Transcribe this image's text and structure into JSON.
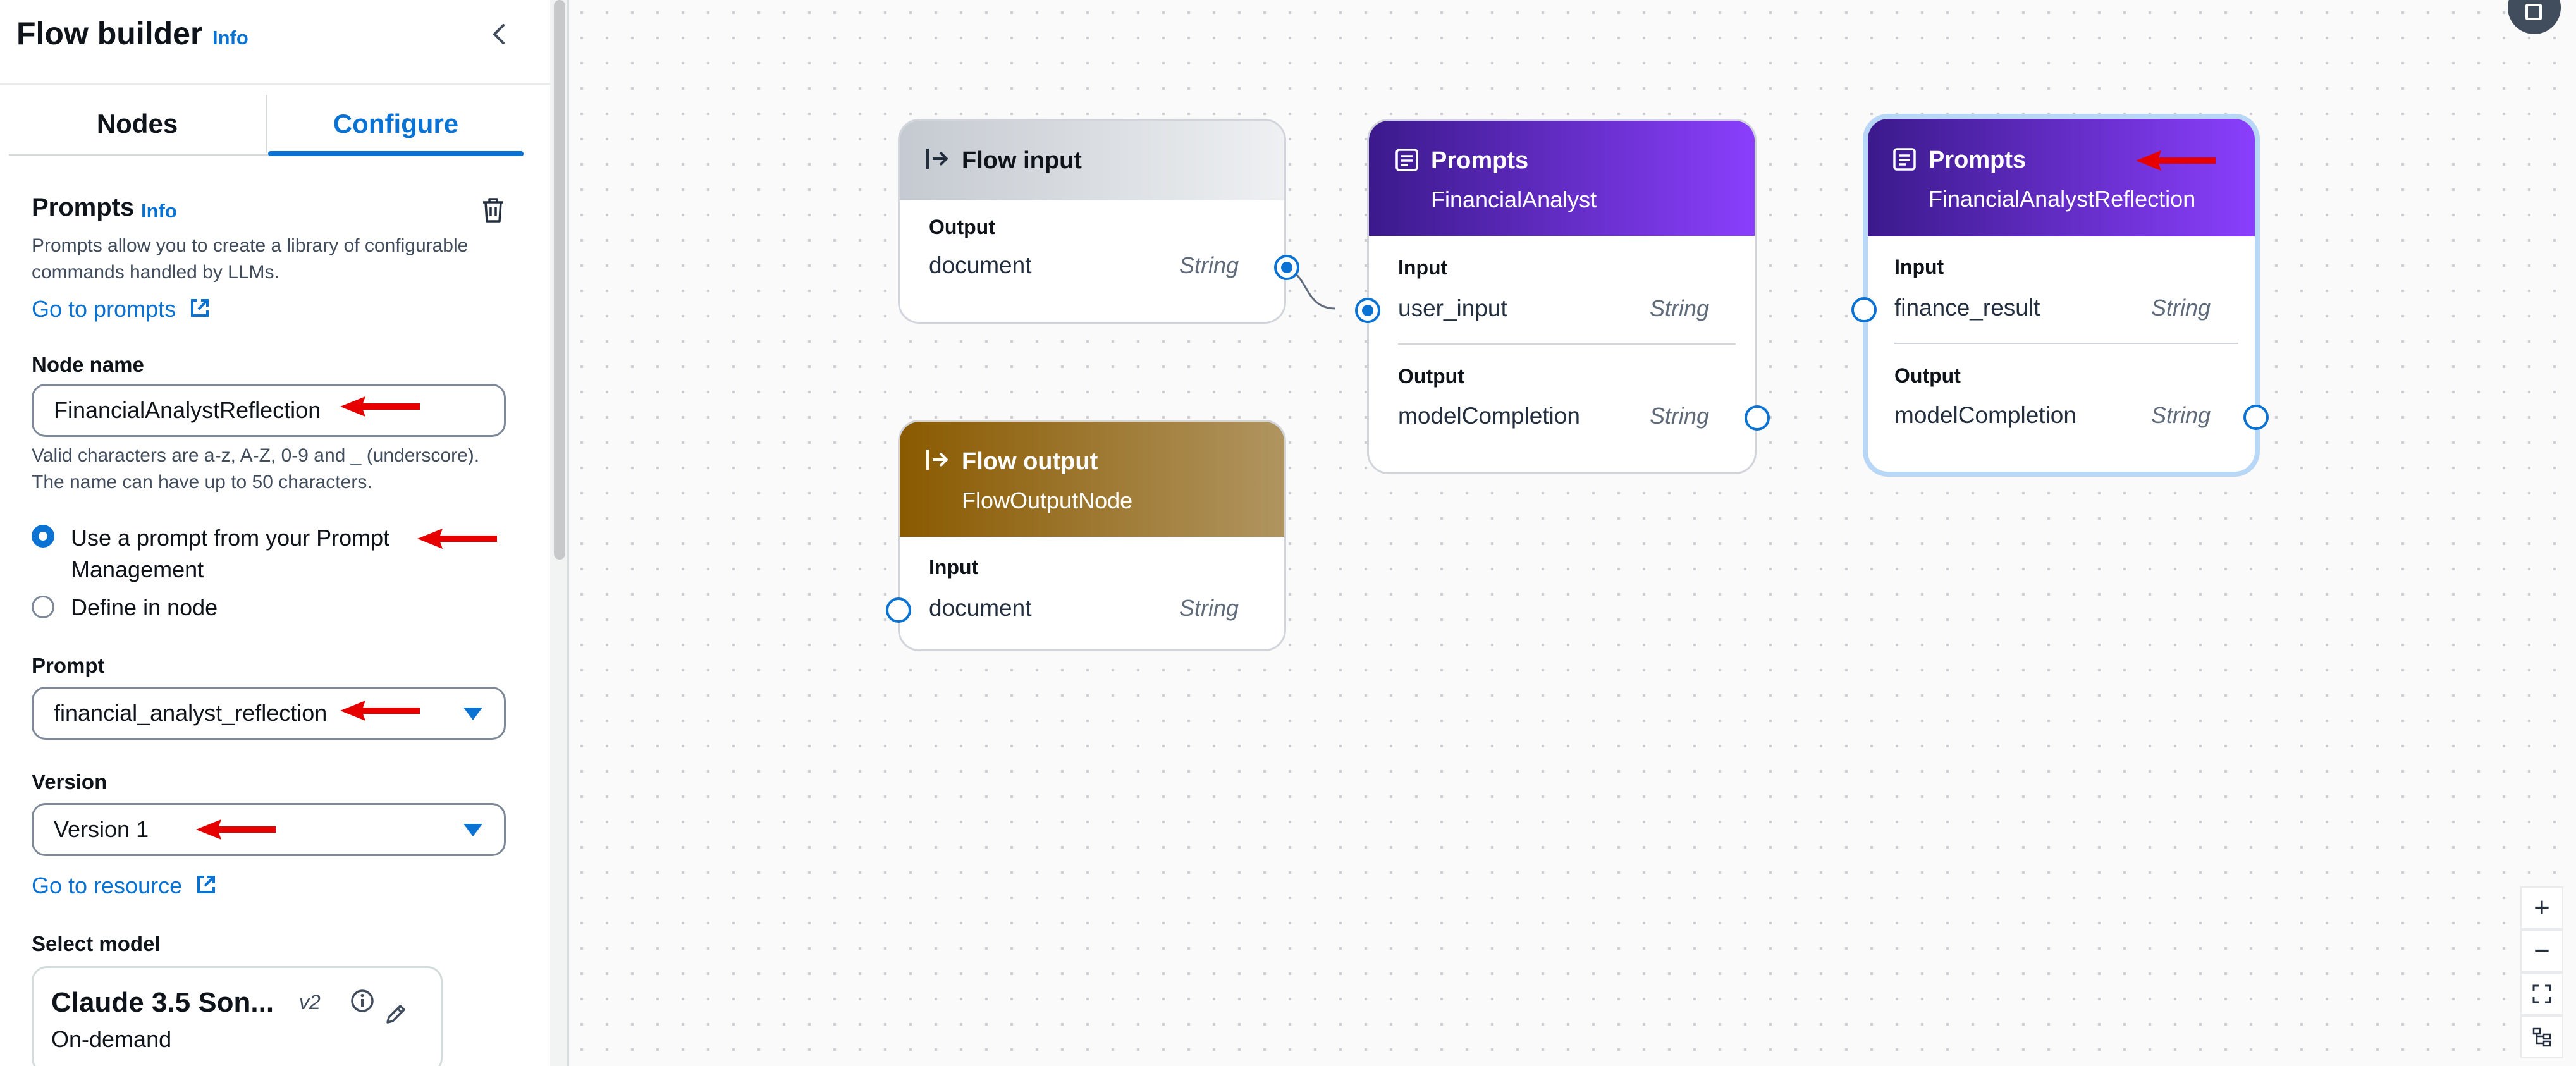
{
  "panel": {
    "title": "Flow builder",
    "info": "Info",
    "tabs": [
      {
        "label": "Nodes"
      },
      {
        "label": "Configure"
      }
    ],
    "section_title": "Prompts",
    "section_info": "Info",
    "description": "Prompts allow you to create a library of configurable commands handled by LLMs.",
    "go_to_prompts": "Go to prompts",
    "node_name_label": "Node name",
    "node_name_value": "FinancialAnalystReflection",
    "node_name_help_1": "Valid characters are a-z, A-Z, 0-9 and _ (underscore).",
    "node_name_help_2": "The name can have up to 50 characters.",
    "radio_option_1_line1": "Use a prompt from your Prompt",
    "radio_option_1_line2": "Management",
    "radio_option_2": "Define in node",
    "prompt_label": "Prompt",
    "prompt_value": "financial_analyst_reflection",
    "version_label": "Version",
    "version_value": "Version 1",
    "go_to_resource": "Go to resource",
    "select_model_label": "Select model",
    "model_name": "Claude 3.5 Son...",
    "model_version": "v2",
    "model_mode": "On-demand"
  },
  "nodes": {
    "flow_input": {
      "title": "Flow input",
      "output_label": "Output",
      "output_name": "document",
      "output_type": "String"
    },
    "flow_output": {
      "title": "Flow output",
      "subtitle": "FlowOutputNode",
      "input_label": "Input",
      "input_name": "document",
      "input_type": "String"
    },
    "financial_analyst": {
      "title": "Prompts",
      "subtitle": "FinancialAnalyst",
      "input_label": "Input",
      "input_name": "user_input",
      "input_type": "String",
      "output_label": "Output",
      "output_name": "modelCompletion",
      "output_type": "String"
    },
    "financial_analyst_reflection": {
      "title": "Prompts",
      "subtitle": "FinancialAnalystReflection",
      "input_label": "Input",
      "input_name": "finance_result",
      "input_type": "String",
      "output_label": "Output",
      "output_name": "modelCompletion",
      "output_type": "String"
    }
  },
  "colors": {
    "accent": "#0972d3",
    "prompt_node_gradient_start": "#3b1a8c",
    "prompt_node_gradient_end": "#8a3ffc",
    "flow_output_gradient_start": "#8a5a00",
    "flow_output_gradient_end": "#b09560",
    "annotation_arrow": "#e60000"
  },
  "icons": [
    "chevron-left-icon",
    "trash-icon",
    "external-link-icon",
    "caret-down-icon",
    "info-icon",
    "pencil-icon",
    "flow-io-icon",
    "prompt-doc-icon",
    "zoom-in-icon",
    "zoom-out-icon",
    "fit-view-icon",
    "layout-icon"
  ]
}
